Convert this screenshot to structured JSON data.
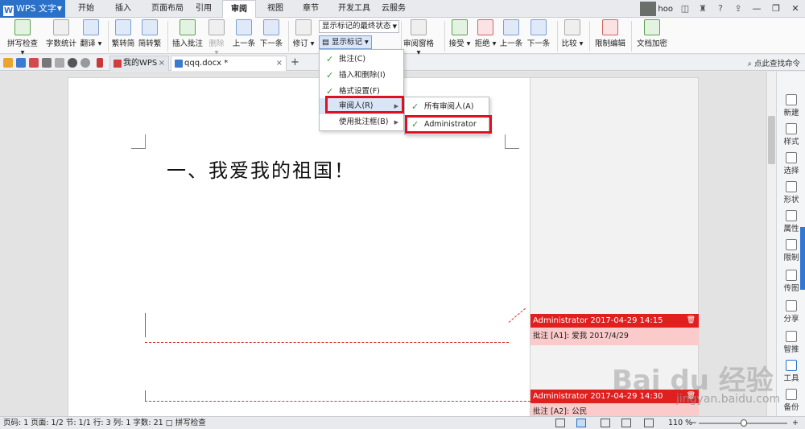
{
  "app": {
    "name": "WPS 文字"
  },
  "menu_tabs": [
    "开始",
    "插入",
    "页面布局",
    "引用",
    "审阅",
    "视图",
    "章节",
    "开发工具",
    "云服务"
  ],
  "active_tab": "审阅",
  "user": {
    "name": "hoo"
  },
  "ribbon": {
    "spell_check": "拼写检查",
    "word_count": "字数统计",
    "translate": "翻译",
    "trad_to_simp": "繁转简",
    "simp_to_trad": "简转繁",
    "insert_comment": "插入批注",
    "delete": "删除",
    "prev1": "上一条",
    "next1": "下一条",
    "track_changes": "修订",
    "display_state": "显示标记的最终状态",
    "show_markup": "显示标记",
    "review_pane": "审阅窗格",
    "accept": "接受",
    "reject": "拒绝",
    "prev2": "上一条",
    "next2": "下一条",
    "compare": "比较",
    "restrict_edit": "限制编辑",
    "encrypt": "文档加密"
  },
  "doc_tabs": [
    {
      "label": "我的WPS"
    },
    {
      "label": "qqq.docx *"
    }
  ],
  "search_command": "点此查找命令",
  "document": {
    "heading": "一、我爱我的祖国！"
  },
  "comments": [
    {
      "author_time": "Administrator 2017-04-29 14:15",
      "body": "批注 [A1]: 爱我 2017/4/29"
    },
    {
      "author_time": "Administrator 2017-04-29 14:30",
      "body": "批注 [A2]: 公民"
    }
  ],
  "show_markup_menu": {
    "items": [
      {
        "label": "批注(C)",
        "checked": true
      },
      {
        "label": "插入和删除(I)",
        "checked": true
      },
      {
        "label": "格式设置(F)",
        "checked": true
      },
      {
        "label": "审阅人(R)",
        "checked": false,
        "submenu": true
      },
      {
        "label": "使用批注框(B)",
        "checked": false,
        "submenu": true
      }
    ]
  },
  "reviewers_menu": {
    "items": [
      {
        "label": "所有审阅人(A)",
        "checked": true
      },
      {
        "label": "Administrator",
        "checked": true
      }
    ]
  },
  "right_panel": [
    "新建",
    "样式",
    "选择",
    "形状",
    "属性",
    "限制",
    "传图",
    "分享",
    "智推",
    "工具",
    "备份"
  ],
  "status": {
    "text": "页码: 1  页面: 1/2  节: 1/1  行: 3  列: 1  字数: 21  □ 拼写检查",
    "zoom": "110 %"
  },
  "watermark": {
    "brand": "Bai du 经验",
    "url": "jingyan.baidu.com"
  },
  "colors": {
    "accent": "#2b70c9",
    "comment_red": "#e01f1f",
    "comment_pink": "#fbcaca",
    "highlight_box": "#e01020"
  }
}
